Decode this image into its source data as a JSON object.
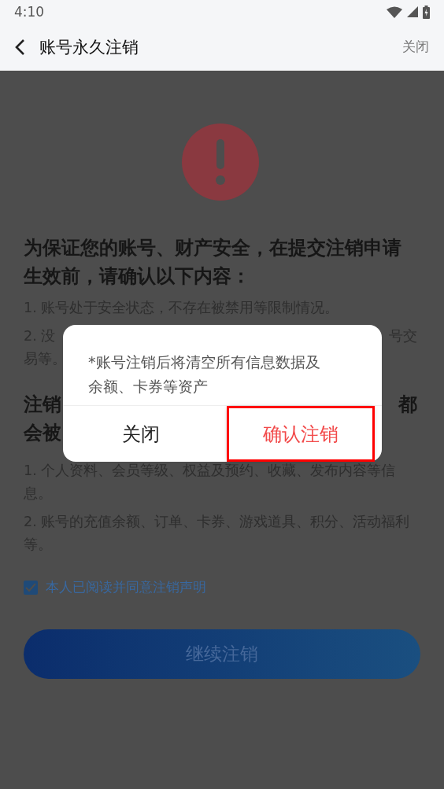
{
  "status_bar": {
    "time": "4:10"
  },
  "header": {
    "title": "账号永久注销",
    "close_label": "关闭"
  },
  "sections": [
    {
      "heading": {
        "kind": "full",
        "lines": [
          [
            "为保证您的账号、财产安全，在提交注销申请生效前，请确认以下内容："
          ]
        ]
      },
      "items": [
        {
          "kind": "full",
          "lines": [
            [
              "1. 账号处于安全状态，不存在被禁用等限制情况。"
            ]
          ]
        },
        {
          "kind": "covered",
          "lines": [
            [
              "2. 没",
              "号交"
            ],
            [
              "易等。"
            ]
          ]
        }
      ]
    },
    {
      "heading": {
        "kind": "covered",
        "lines": [
          [
            "注销",
            "都"
          ],
          [
            "会被"
          ]
        ]
      },
      "items": [
        {
          "kind": "full",
          "lines": [
            [
              "1. 个人资料、会员等级、权益及预约、收藏、发布内容等信息。"
            ]
          ]
        },
        {
          "kind": "full",
          "lines": [
            [
              "2. 账号的充值余额、订单、卡券、游戏道具、积分、活动福利等。"
            ]
          ]
        }
      ]
    }
  ],
  "agreement": {
    "checked": true,
    "label": "本人已阅读并同意注销声明"
  },
  "continue_button": {
    "label": "继续注销"
  },
  "dialog": {
    "message": "*账号注销后将清空所有信息数据及余额、卡券等资产",
    "buttons": [
      {
        "label": "关闭",
        "kind": "cancel",
        "highlighted": false
      },
      {
        "label": "确认注销",
        "kind": "danger",
        "highlighted": true
      }
    ]
  }
}
